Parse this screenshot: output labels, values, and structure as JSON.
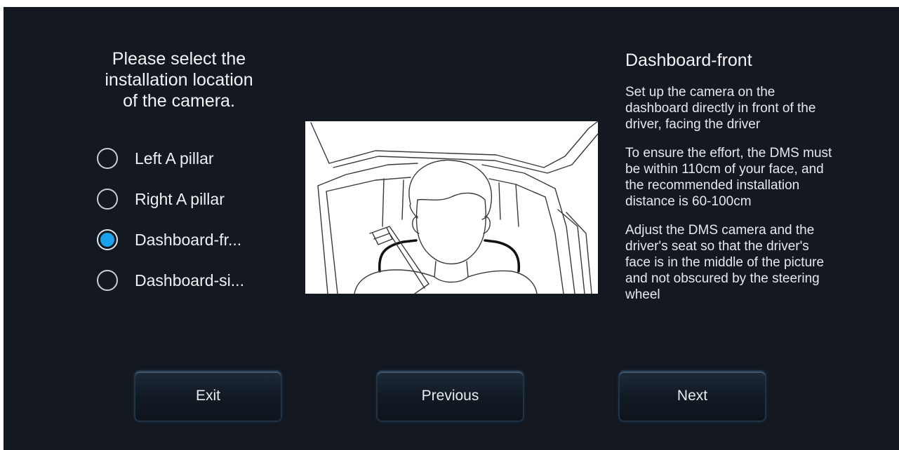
{
  "prompt": {
    "line1": "Please select the",
    "line2": "installation location",
    "line3": "of the camera."
  },
  "options": [
    {
      "label": "Left A pillar",
      "selected": false
    },
    {
      "label": "Right A pillar",
      "selected": false
    },
    {
      "label": "Dashboard-fr...",
      "selected": true
    },
    {
      "label": "Dashboard-si...",
      "selected": false
    }
  ],
  "info": {
    "title": "Dashboard-front",
    "paragraphs": [
      "Set up the camera on the dashboard directly in front of the driver, facing the driver",
      "To ensure the effort, the DMS must be within 110cm of your face, and the recommended installation distance is 60-100cm",
      "Adjust the DMS camera and the driver's seat so that the driver's face is in the middle of the picture and not obscured by the steering wheel"
    ]
  },
  "buttons": {
    "exit": "Exit",
    "previous": "Previous",
    "next": "Next"
  },
  "colors": {
    "background": "#141820",
    "accent": "#1aa3ea",
    "text": "#eef0f2"
  },
  "icons": {
    "radio_selected": "radio-checked-icon",
    "radio_unselected": "radio-unchecked-icon"
  }
}
